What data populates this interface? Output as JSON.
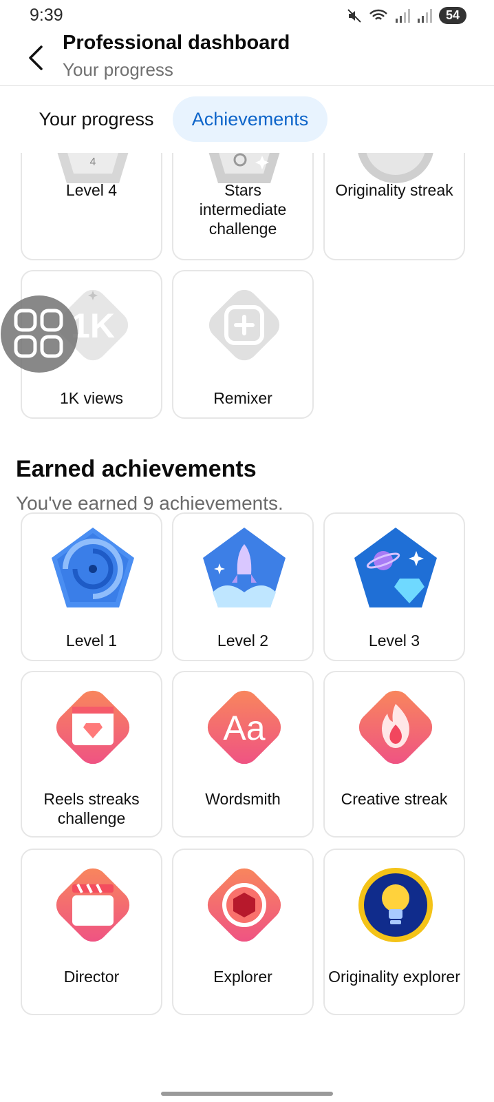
{
  "status_bar": {
    "time": "9:39",
    "battery": "54"
  },
  "header": {
    "title": "Professional dashboard",
    "subtitle": "Your progress"
  },
  "tabs": [
    {
      "label": "Your progress"
    },
    {
      "label": "Achievements"
    }
  ],
  "locked": [
    {
      "label": "Level 4",
      "icon": "level-4-badge"
    },
    {
      "label": "Stars intermediate challenge",
      "icon": "stars-badge"
    },
    {
      "label": "Originality streak",
      "icon": "originality-streak-badge"
    },
    {
      "label": "1K views",
      "icon": "1k-views-badge",
      "badge_text": "1K"
    },
    {
      "label": "Remixer",
      "icon": "remixer-badge"
    }
  ],
  "earned": {
    "title": "Earned achievements",
    "subtitle": "You've earned 9 achievements.",
    "items": [
      {
        "label": "Level 1",
        "icon": "galaxy-badge"
      },
      {
        "label": "Level 2",
        "icon": "rocket-badge"
      },
      {
        "label": "Level 3",
        "icon": "planet-gem-badge"
      },
      {
        "label": "Reels streaks challenge",
        "icon": "reels-diamond-badge"
      },
      {
        "label": "Wordsmith",
        "icon": "text-badge",
        "badge_text": "Aa"
      },
      {
        "label": "Creative streak",
        "icon": "flame-badge"
      },
      {
        "label": "Director",
        "icon": "clapperboard-badge"
      },
      {
        "label": "Explorer",
        "icon": "aperture-badge"
      },
      {
        "label": "Originality explorer",
        "icon": "lightbulb-badge"
      }
    ]
  },
  "level4_number": "4"
}
